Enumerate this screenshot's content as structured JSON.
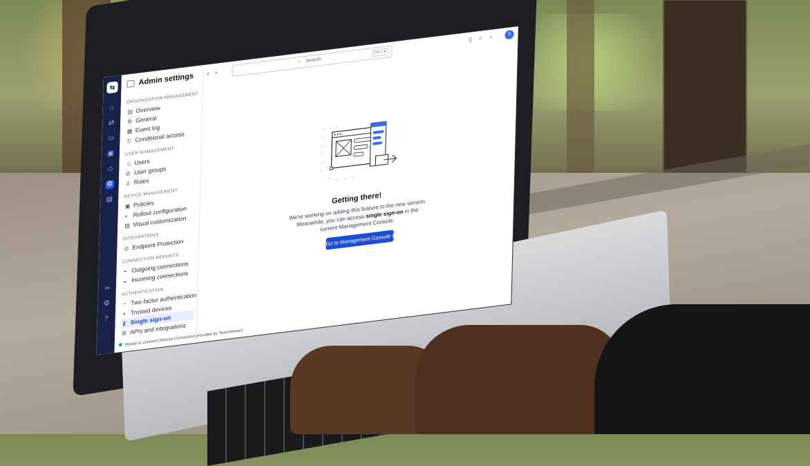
{
  "app": {
    "title": "Admin settings",
    "search_placeholder": "Search",
    "search_shortcut": "Ctrl + K",
    "avatar_initials": "S"
  },
  "sidebar": {
    "sections": [
      {
        "title": "ORGANIZATION MANAGEMENT",
        "items": [
          "Overview",
          "General",
          "Event log",
          "Conditional access"
        ]
      },
      {
        "title": "USER MANAGEMENT",
        "items": [
          "Users",
          "User groups",
          "Roles"
        ]
      },
      {
        "title": "DEVICE MANAGEMENT",
        "items": [
          "Policies",
          "Rollout configuration",
          "Visual customization"
        ]
      },
      {
        "title": "INTEGRATIONS",
        "items": [
          "Endpoint Protection"
        ]
      },
      {
        "title": "CONNECTION REPORTS",
        "items": [
          "Outgoing connections",
          "Incoming connections"
        ]
      },
      {
        "title": "AUTHENTICATION",
        "items": [
          "Two-factor authentication",
          "Trusted devices",
          "Single sign-on",
          "APIs and integrations"
        ]
      }
    ],
    "active_item": "Single sign-on",
    "status": "Ready to connect (Secure Connection provided by TeamViewer)"
  },
  "main": {
    "heading": "Getting there!",
    "text_before": "We're working on adding this feature to the new version. Meanwhile, you can access ",
    "text_bold": "single sign-on",
    "text_after": " in the current Management Console.",
    "button_label": "Go to Management Console",
    "button_icon": "external-link-icon"
  },
  "colors": {
    "rail_bg": "#182248",
    "accent": "#1d4ed8",
    "active_bg": "#e8eeff",
    "status_green": "#1fb45a"
  }
}
